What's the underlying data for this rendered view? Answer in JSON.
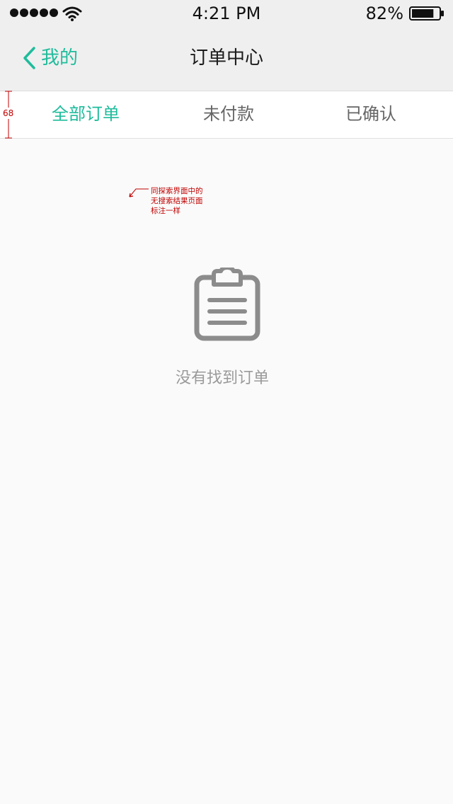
{
  "status_bar": {
    "time": "4:21 PM",
    "battery_percent": "82%",
    "battery_level": 0.82,
    "signal_bars": 5
  },
  "nav": {
    "back_label": "我的",
    "title": "订单中心"
  },
  "tabs": [
    {
      "label": "全部订单",
      "active": true
    },
    {
      "label": "未付款",
      "active": false
    },
    {
      "label": "已确认",
      "active": false
    }
  ],
  "annotations": {
    "tab_height_label": "68",
    "design_note": "同探索界面中的\n无搜索结果页面\n标注一样"
  },
  "empty_state": {
    "icon": "clipboard-icon",
    "message": "没有找到订单"
  },
  "colors": {
    "accent": "#1fbc9c",
    "annotation": "#c00000",
    "muted_text": "#9a9a9a",
    "icon_gray": "#8c8c8c"
  }
}
